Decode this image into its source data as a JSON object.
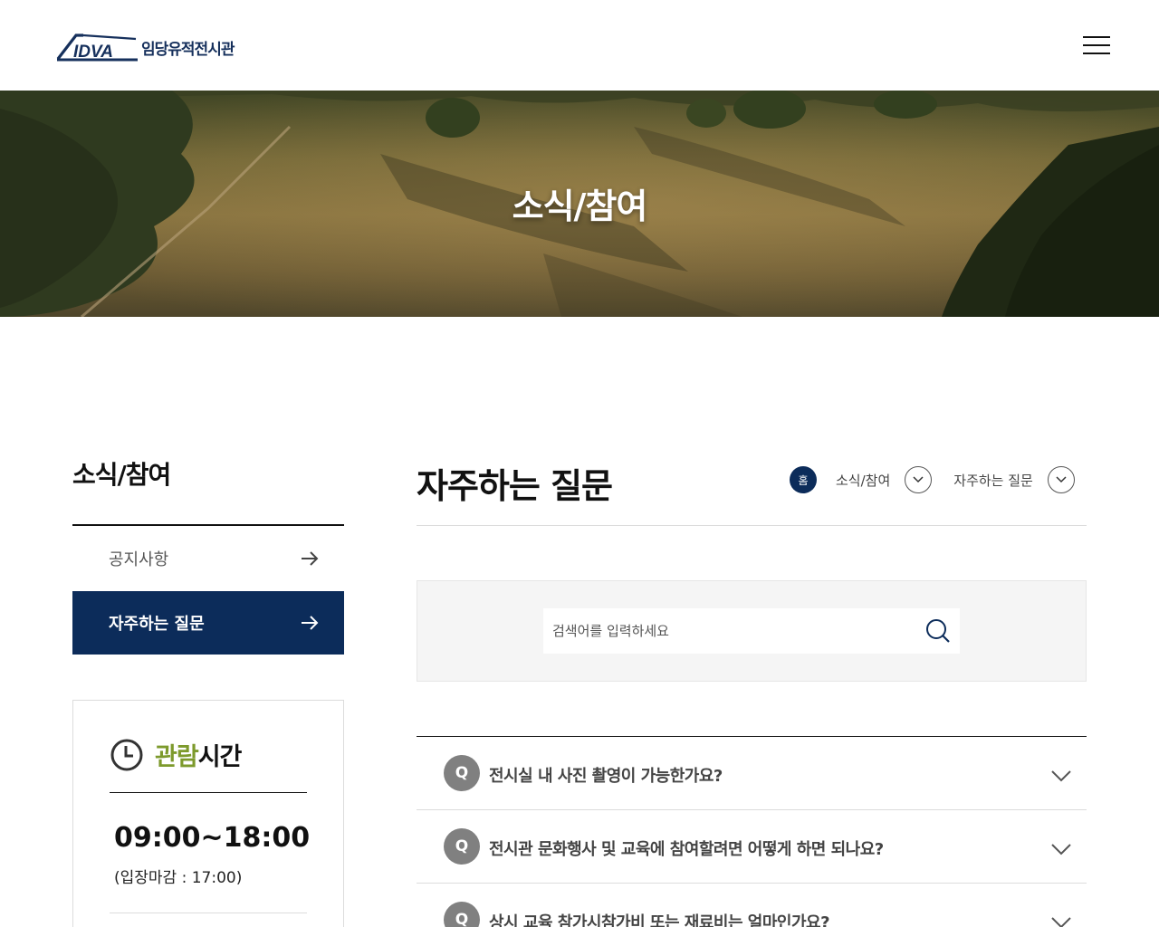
{
  "header": {
    "logo_mark": "IDVA",
    "logo_text": "임당유적전시관",
    "menu_icon": "hamburger-icon"
  },
  "hero": {
    "title": "소식/참여"
  },
  "sidebar": {
    "title": "소식/참여",
    "items": [
      {
        "label": "공지사항",
        "active": false,
        "icon": "arrow-right-icon"
      },
      {
        "label": "자주하는 질문",
        "active": true,
        "icon": "arrow-right-icon"
      }
    ]
  },
  "hours": {
    "icon": "clock-icon",
    "title_accent": "관람",
    "title_rest": "시간",
    "time": "09:00~18:00",
    "note": "(입장마감 : 17:00)"
  },
  "main": {
    "title": "자주하는 질문",
    "breadcrumb": {
      "home": "홈",
      "level1": "소식/참여",
      "level2": "자주하는 질문"
    },
    "search": {
      "placeholder": "검색어를 입력하세요",
      "value": ""
    }
  },
  "faq": {
    "q_badge": "Q",
    "items": [
      {
        "question": "전시실 내 사진 촬영이 가능한가요?"
      },
      {
        "question": "전시관 문화행사 및 교육에 참여할려면 어떻게 하면 되나요?"
      },
      {
        "question": "상시 교육 참가시참가비 또는 재료비는 얼마인가요?"
      }
    ]
  },
  "colors": {
    "primary_navy": "#0c2c5a",
    "accent_green": "#7d9a2c",
    "q_badge_gray": "#808080"
  }
}
